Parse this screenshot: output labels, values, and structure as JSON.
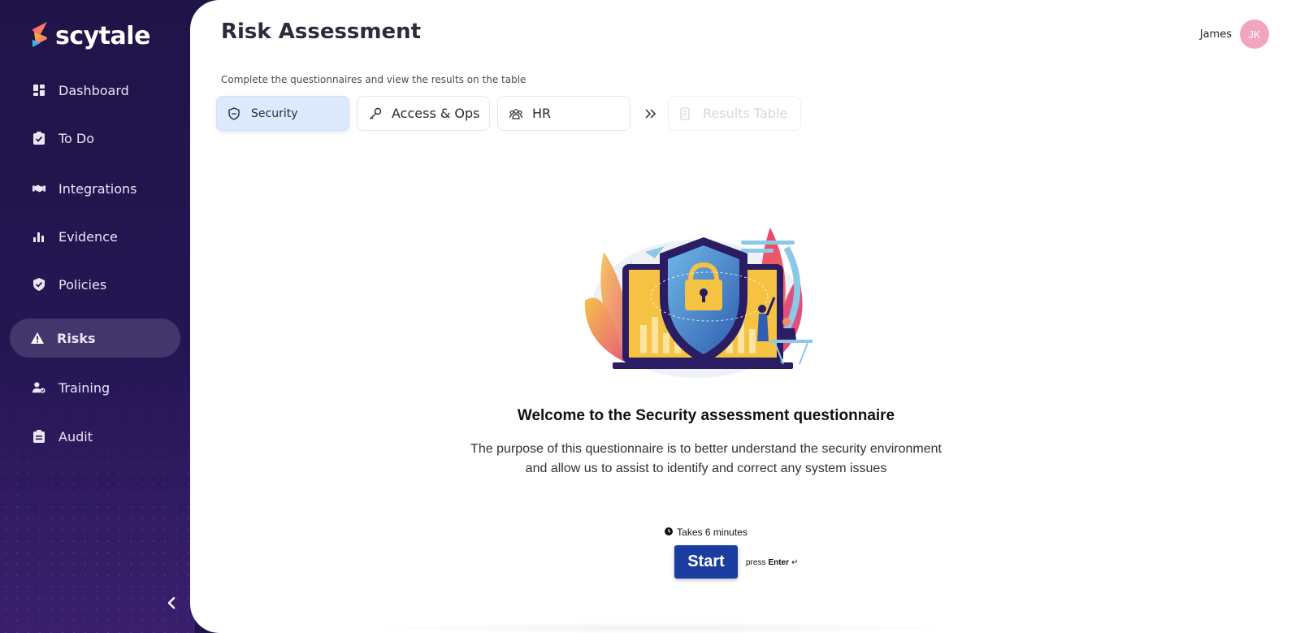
{
  "brand": {
    "name": "scytale"
  },
  "sidebar": {
    "items": [
      {
        "label": "Dashboard",
        "icon": "dashboard-icon"
      },
      {
        "label": "To Do",
        "icon": "clipboard-check-icon"
      },
      {
        "label": "Integrations",
        "icon": "handshake-icon"
      },
      {
        "label": "Evidence",
        "icon": "bar-chart-icon"
      },
      {
        "label": "Policies",
        "icon": "shield-check-icon"
      },
      {
        "label": "Risks",
        "icon": "warning-icon",
        "active": true
      },
      {
        "label": "Training",
        "icon": "user-check-icon"
      },
      {
        "label": "Audit",
        "icon": "clipboard-list-icon"
      }
    ],
    "collapse_icon": "chevron-left-icon"
  },
  "header": {
    "title": "Risk Assessment",
    "user_name": "James",
    "avatar_initials": "JK"
  },
  "main": {
    "subtitle": "Complete the questionnaires and view the results on the table",
    "tabs": [
      {
        "label": "Security",
        "icon": "shield-icon",
        "state": "active"
      },
      {
        "label": "Access & Ops",
        "icon": "key-icon",
        "state": "default"
      },
      {
        "label": "HR",
        "icon": "people-icon",
        "state": "default"
      },
      {
        "label": "Results Table",
        "icon": "document-icon",
        "state": "disabled"
      }
    ],
    "welcome_title": "Welcome to the Security assessment questionnaire",
    "description_line1": "The purpose of this questionnaire is to better understand the security environment",
    "description_line2": "and allow us to assist to identify and correct any system issues",
    "duration": "Takes 6 minutes",
    "start_label": "Start",
    "press_prefix": "press",
    "press_key": "Enter",
    "press_symbol": "↵"
  },
  "colors": {
    "sidebar_bg": "#1f1448",
    "active_tab_bg": "#dde9fc",
    "start_button": "#1b3d9f",
    "avatar_bg": "#f3a4bf"
  }
}
